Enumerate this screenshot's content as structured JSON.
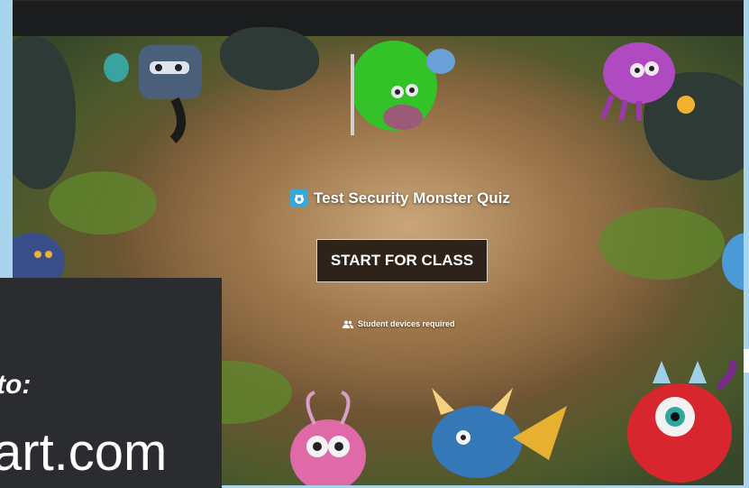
{
  "quiz": {
    "title": "Test Security Monster Quiz",
    "icon": "monster-quiz-icon"
  },
  "start_button": {
    "label": "START FOR CLASS"
  },
  "devices_note": {
    "text": "Student devices required",
    "icon": "people-icon"
  },
  "overlay": {
    "line1": "to:",
    "line2": "art.com"
  },
  "colors": {
    "topbar": "#1b1c1d",
    "button_bg": "#2d231b",
    "button_border": "#d8d2c8",
    "icon_bg": "#3aa7d8",
    "overlay_bg": "#2a2c2f"
  }
}
